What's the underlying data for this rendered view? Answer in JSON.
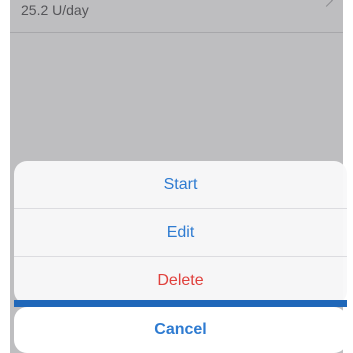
{
  "info_row": {
    "text": "25.2 U/day"
  },
  "action_sheet": {
    "actions": [
      {
        "label": "Start"
      },
      {
        "label": "Edit"
      },
      {
        "label": "Delete"
      }
    ],
    "cancel_label": "Cancel"
  },
  "colors": {
    "action_text": "#2e7bd1",
    "destructive_text": "#e0403c",
    "strip": "#1f67b9"
  }
}
